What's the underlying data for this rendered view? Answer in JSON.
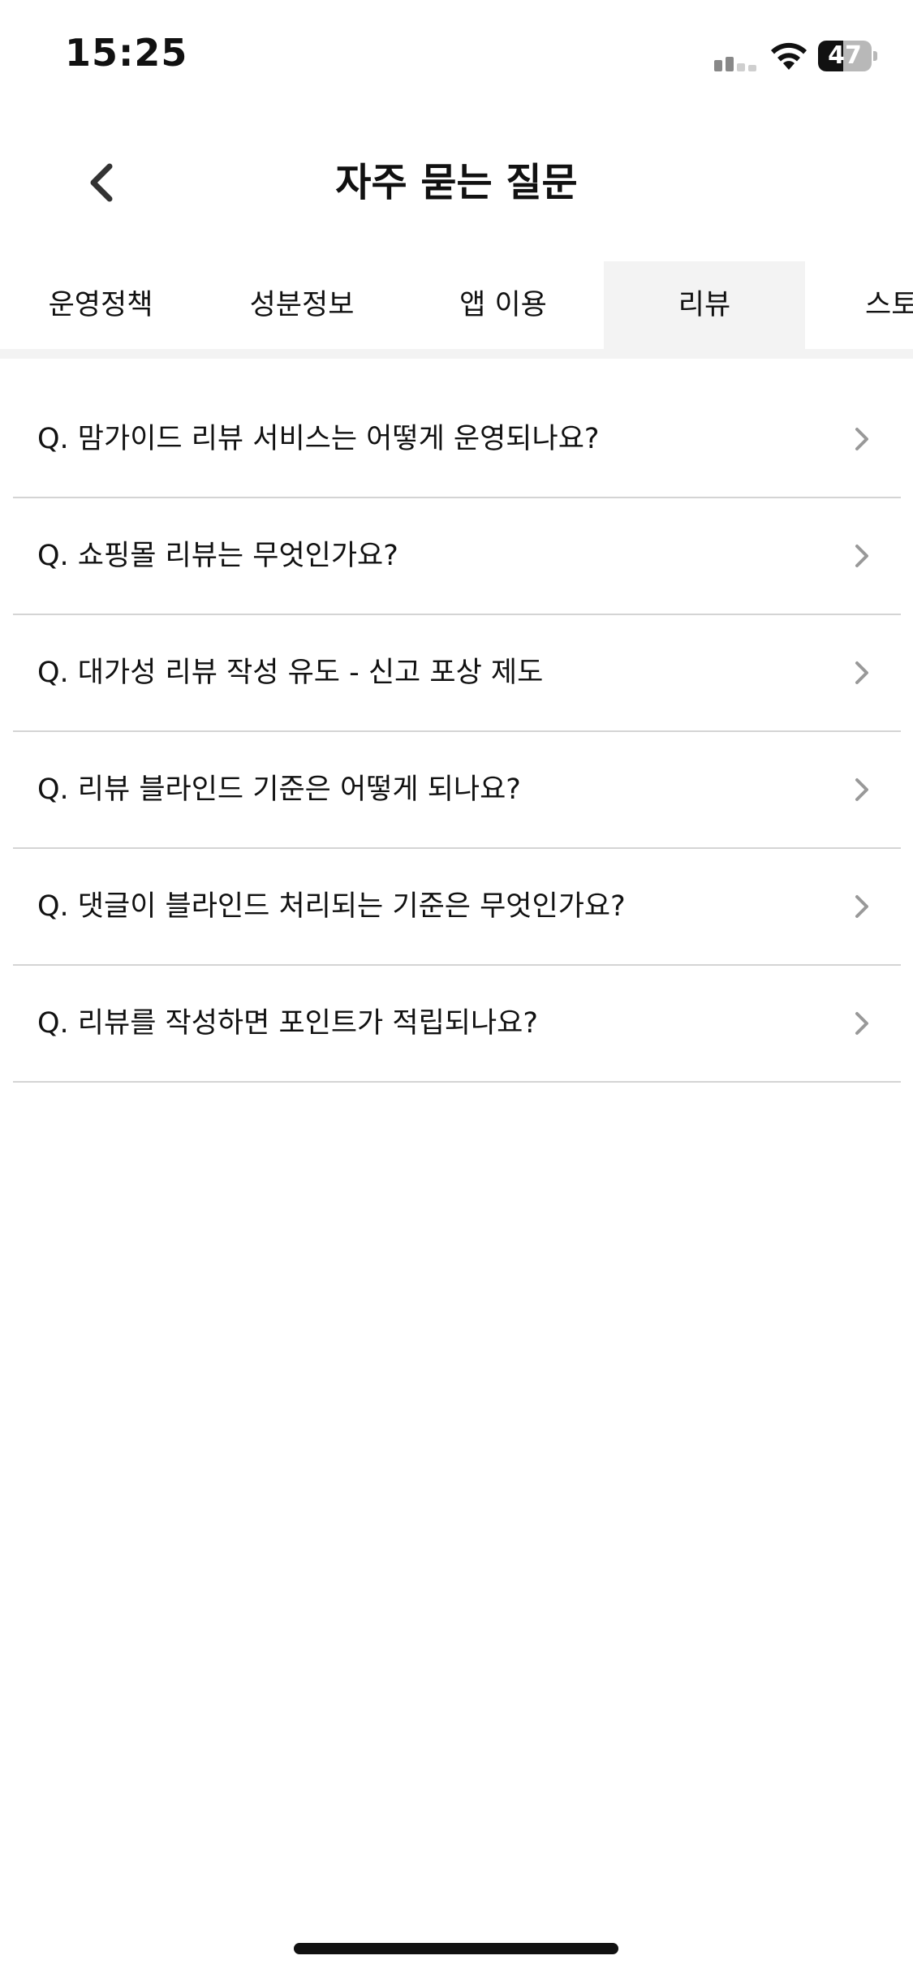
{
  "status_bar": {
    "time": "15:25",
    "battery_level": "47",
    "battery_fraction": 0.47,
    "icons": [
      "signal-icon",
      "wifi-icon",
      "battery-icon"
    ]
  },
  "header": {
    "title": "자주 묻는 질문",
    "back_icon": "chevron-left-icon"
  },
  "tabs": [
    {
      "label": "운영정책",
      "active": false
    },
    {
      "label": "성분정보",
      "active": false
    },
    {
      "label": "앱 이용",
      "active": false
    },
    {
      "label": "리뷰",
      "active": true
    },
    {
      "label": "스토",
      "active": false
    }
  ],
  "faq": {
    "item_icon": "chevron-right-icon",
    "items": [
      "Q. 맘가이드 리뷰 서비스는 어떻게 운영되나요?",
      "Q. 쇼핑몰 리뷰는 무엇인가요?",
      "Q. 대가성 리뷰 작성 유도 - 신고 포상 제도",
      "Q. 리뷰 블라인드 기준은 어떻게 되나요?",
      "Q. 댓글이 블라인드 처리되는 기준은 무엇인가요?",
      "Q. 리뷰를 작성하면 포인트가 적립되나요?"
    ]
  },
  "colors": {
    "text": "#111111",
    "active_tab_bg": "#f3f3f3",
    "divider": "#d4d4d4",
    "chevron": "#999999"
  }
}
